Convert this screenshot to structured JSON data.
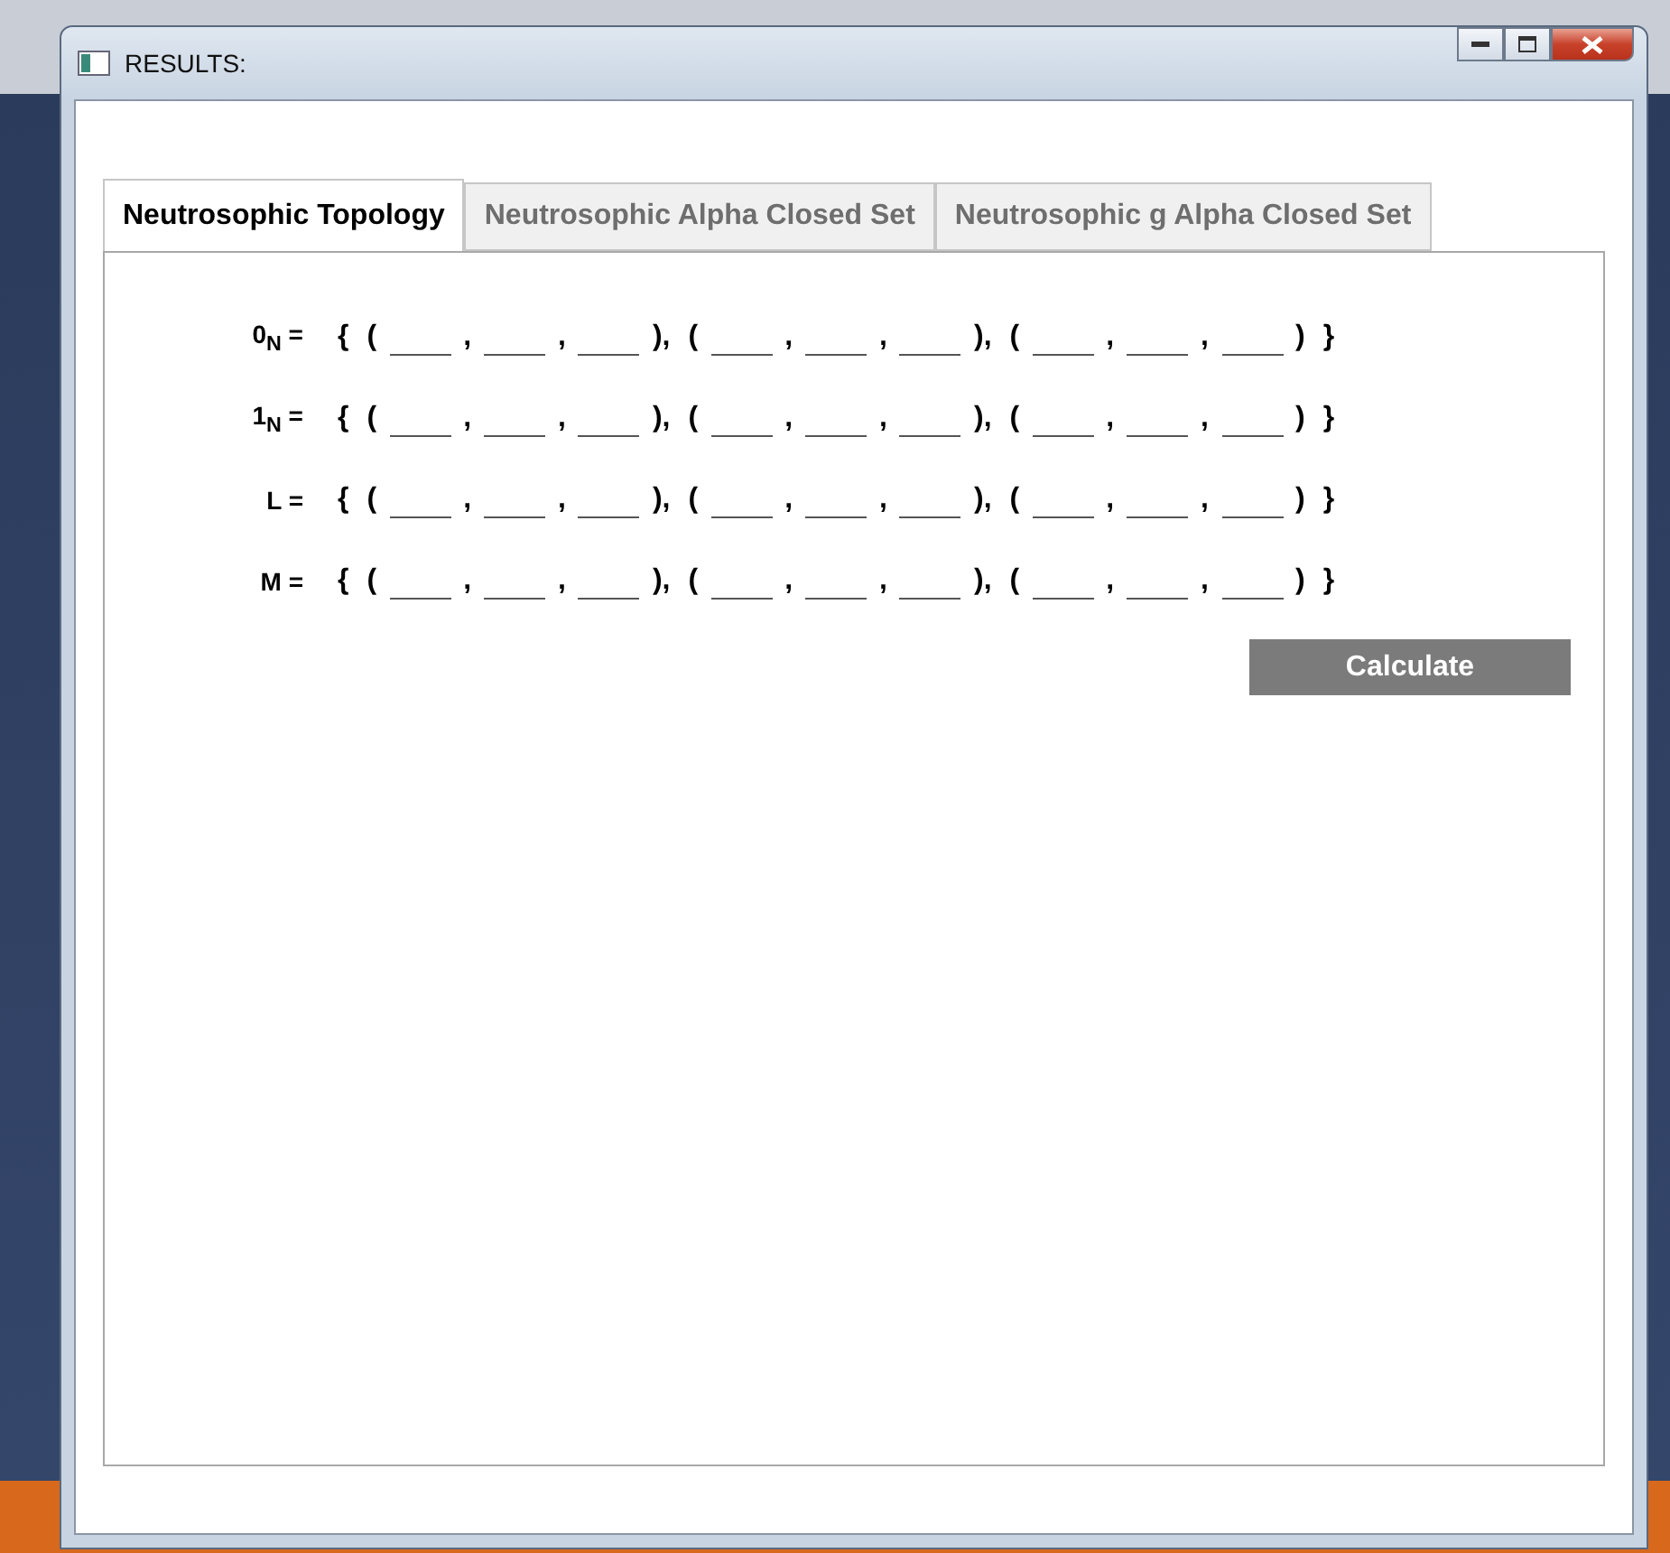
{
  "window": {
    "title": "RESULTS:"
  },
  "tabs": [
    {
      "label": "Neutrosophic Topology",
      "selected": true
    },
    {
      "label": "Neutrosophic Alpha Closed Set",
      "selected": false
    },
    {
      "label": "Neutrosophic g Alpha Closed Set",
      "selected": false
    }
  ],
  "rows": [
    {
      "label": "0$_{N}$ =",
      "tokens": [
        {
          "kind": "sym",
          "text": "{"
        },
        {
          "kind": "sym",
          "text": "("
        },
        {
          "kind": "blank"
        },
        {
          "kind": "sym",
          "text": ","
        },
        {
          "kind": "blank"
        },
        {
          "kind": "sym",
          "text": ","
        },
        {
          "kind": "blank"
        },
        {
          "kind": "sym",
          "text": "),"
        },
        {
          "kind": "sym",
          "text": "("
        },
        {
          "kind": "blank"
        },
        {
          "kind": "sym",
          "text": ","
        },
        {
          "kind": "blank"
        },
        {
          "kind": "sym",
          "text": ","
        },
        {
          "kind": "blank"
        },
        {
          "kind": "sym",
          "text": "),"
        },
        {
          "kind": "sym",
          "text": "("
        },
        {
          "kind": "blank"
        },
        {
          "kind": "sym",
          "text": ","
        },
        {
          "kind": "blank"
        },
        {
          "kind": "sym",
          "text": ","
        },
        {
          "kind": "blank"
        },
        {
          "kind": "sym",
          "text": ")"
        },
        {
          "kind": "sym",
          "text": "}"
        }
      ]
    },
    {
      "label": "1$_{N}$ =",
      "tokens": [
        {
          "kind": "sym",
          "text": "{"
        },
        {
          "kind": "sym",
          "text": "("
        },
        {
          "kind": "blank"
        },
        {
          "kind": "sym",
          "text": ","
        },
        {
          "kind": "blank"
        },
        {
          "kind": "sym",
          "text": ","
        },
        {
          "kind": "blank"
        },
        {
          "kind": "sym",
          "text": "),"
        },
        {
          "kind": "sym",
          "text": "("
        },
        {
          "kind": "blank"
        },
        {
          "kind": "sym",
          "text": ","
        },
        {
          "kind": "blank"
        },
        {
          "kind": "sym",
          "text": ","
        },
        {
          "kind": "blank"
        },
        {
          "kind": "sym",
          "text": "),"
        },
        {
          "kind": "sym",
          "text": "("
        },
        {
          "kind": "blank"
        },
        {
          "kind": "sym",
          "text": ","
        },
        {
          "kind": "blank"
        },
        {
          "kind": "sym",
          "text": ","
        },
        {
          "kind": "blank"
        },
        {
          "kind": "sym",
          "text": ")"
        },
        {
          "kind": "sym",
          "text": "}"
        }
      ]
    },
    {
      "label": "L =",
      "tokens": [
        {
          "kind": "sym",
          "text": "{"
        },
        {
          "kind": "sym",
          "text": "("
        },
        {
          "kind": "blank"
        },
        {
          "kind": "sym",
          "text": ","
        },
        {
          "kind": "blank"
        },
        {
          "kind": "sym",
          "text": ","
        },
        {
          "kind": "blank"
        },
        {
          "kind": "sym",
          "text": "),"
        },
        {
          "kind": "sym",
          "text": "("
        },
        {
          "kind": "blank"
        },
        {
          "kind": "sym",
          "text": ","
        },
        {
          "kind": "blank"
        },
        {
          "kind": "sym",
          "text": ","
        },
        {
          "kind": "blank"
        },
        {
          "kind": "sym",
          "text": "),"
        },
        {
          "kind": "sym",
          "text": "("
        },
        {
          "kind": "blank"
        },
        {
          "kind": "sym",
          "text": ","
        },
        {
          "kind": "blank"
        },
        {
          "kind": "sym",
          "text": ","
        },
        {
          "kind": "blank"
        },
        {
          "kind": "sym",
          "text": ")"
        },
        {
          "kind": "sym",
          "text": "}"
        }
      ]
    },
    {
      "label": "M =",
      "tokens": [
        {
          "kind": "sym",
          "text": "{"
        },
        {
          "kind": "sym",
          "text": "("
        },
        {
          "kind": "blank"
        },
        {
          "kind": "sym",
          "text": ","
        },
        {
          "kind": "blank"
        },
        {
          "kind": "sym",
          "text": ","
        },
        {
          "kind": "blank"
        },
        {
          "kind": "sym",
          "text": "),"
        },
        {
          "kind": "sym",
          "text": "("
        },
        {
          "kind": "blank"
        },
        {
          "kind": "sym",
          "text": ","
        },
        {
          "kind": "blank"
        },
        {
          "kind": "sym",
          "text": ","
        },
        {
          "kind": "blank"
        },
        {
          "kind": "sym",
          "text": "),"
        },
        {
          "kind": "sym",
          "text": "("
        },
        {
          "kind": "blank"
        },
        {
          "kind": "sym",
          "text": ","
        },
        {
          "kind": "blank"
        },
        {
          "kind": "sym",
          "text": ","
        },
        {
          "kind": "blank"
        },
        {
          "kind": "sym",
          "text": ")"
        },
        {
          "kind": "sym",
          "text": "}"
        }
      ]
    }
  ],
  "button": "Calculate"
}
